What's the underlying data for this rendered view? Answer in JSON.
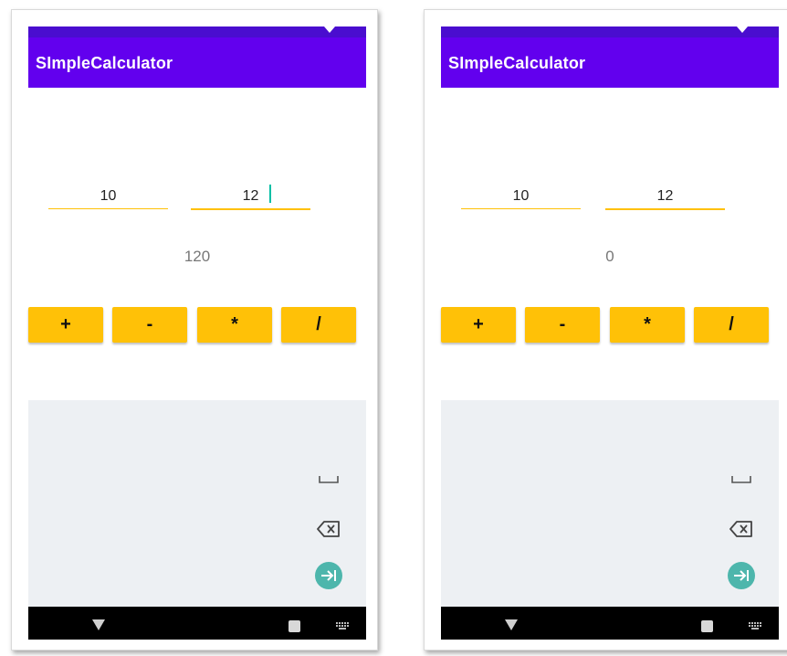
{
  "screens": [
    {
      "app_title": "SImpleCalculator",
      "number1": "10",
      "number2": "12",
      "result": "120",
      "focused_field": "number2",
      "operators": [
        "+",
        "-",
        "*",
        "/"
      ],
      "keyboard_icons": [
        "space-icon",
        "backspace-icon",
        "next-icon"
      ],
      "nav_icons": [
        "back-icon",
        "recent-apps-icon",
        "keyboard-switch-icon"
      ]
    },
    {
      "app_title": "SImpleCalculator",
      "number1": "10",
      "number2": "12",
      "result": "0",
      "focused_field": "number2",
      "operators": [
        "+",
        "-",
        "*",
        "/"
      ],
      "keyboard_icons": [
        "space-icon",
        "backspace-icon",
        "next-icon"
      ],
      "nav_icons": [
        "back-icon",
        "recent-apps-icon",
        "keyboard-switch-icon"
      ]
    }
  ],
  "colors": {
    "status_bar": "#4a0dcf",
    "app_bar": "#6200ee",
    "accent": "#ffc107",
    "keyboard_bg": "#edf0f3",
    "next_key": "#4db6ac",
    "nav_bar": "#000000"
  }
}
